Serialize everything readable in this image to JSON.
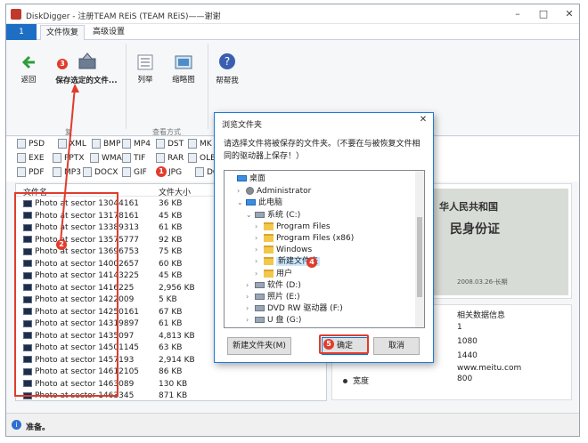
{
  "window": {
    "title": "DiskDigger - 注册TEAM REiS (TEAM REiS)——谢谢"
  },
  "ribbon_tabs": [
    {
      "label": "1"
    },
    {
      "label": "文件恢复"
    },
    {
      "label": "高级设置"
    }
  ],
  "ribbon": {
    "back": "返回",
    "save_selected": "保存选定的文件...",
    "list": "列举",
    "thumbs": "缩略图",
    "help": "帮帮我",
    "group_recover": "复",
    "group_view": "查看方式",
    "group_help": "帮"
  },
  "filters": {
    "row1": [
      "PSD",
      "XML",
      "BMP",
      "MP4",
      "DST",
      "MK"
    ],
    "row2": [
      "EXE",
      "PPTX",
      "WMA",
      "TIF",
      "RAR",
      "OLE"
    ],
    "row3": [
      "PDF",
      "MP3",
      "DOCX",
      "GIF",
      "JPG",
      "DOC"
    ]
  },
  "file_list": {
    "col_name": "文件名",
    "col_size": "文件大小",
    "rows": [
      {
        "name": "Photo at sector 13044161",
        "size": "36 KB"
      },
      {
        "name": "Photo at sector 13178161",
        "size": "45 KB"
      },
      {
        "name": "Photo at sector 13389313",
        "size": "61 KB"
      },
      {
        "name": "Photo at sector 13575777",
        "size": "92 KB"
      },
      {
        "name": "Photo at sector 13696753",
        "size": "75 KB"
      },
      {
        "name": "Photo at sector 14002657",
        "size": "60 KB"
      },
      {
        "name": "Photo at sector 14143225",
        "size": "45 KB"
      },
      {
        "name": "Photo at sector 1416225",
        "size": "2,956 KB"
      },
      {
        "name": "Photo at sector 1422009",
        "size": "5 KB"
      },
      {
        "name": "Photo at sector 14250161",
        "size": "67 KB"
      },
      {
        "name": "Photo at sector 14319897",
        "size": "61 KB"
      },
      {
        "name": "Photo at sector 1435097",
        "size": "4,813 KB"
      },
      {
        "name": "Photo at sector 14501145",
        "size": "63 KB"
      },
      {
        "name": "Photo at sector 1457193",
        "size": "2,914 KB"
      },
      {
        "name": "Photo at sector 14612105",
        "size": "86 KB"
      },
      {
        "name": "Photo at sector 1463089",
        "size": "130 KB"
      },
      {
        "name": "Photo at sector 1463345",
        "size": "871 KB"
      }
    ]
  },
  "preview_text": {
    "line1": "华人民共和国",
    "line2": "民身份证",
    "line3": "2008.03.26-长期"
  },
  "props": {
    "header": "相关数据信息",
    "values": [
      "1",
      "1080",
      "1440",
      "www.meitu.com",
      "800"
    ],
    "width_label": "宽度"
  },
  "dialog": {
    "title": "浏览文件夹",
    "instruction": "请选择文件将被保存的文件夹。（不要在与被恢复文件相同的驱动器上保存！）",
    "tree": [
      {
        "label": "桌面",
        "level": 0,
        "icon": "desktop-icon"
      },
      {
        "label": "Administrator",
        "level": 1,
        "icon": "user-icon"
      },
      {
        "label": "此电脑",
        "level": 1,
        "icon": "computer-icon"
      },
      {
        "label": "系统 (C:)",
        "level": 2,
        "icon": "drive-icon"
      },
      {
        "label": "Program Files",
        "level": 3,
        "icon": "folder-icon"
      },
      {
        "label": "Program Files (x86)",
        "level": 3,
        "icon": "folder-icon"
      },
      {
        "label": "Windows",
        "level": 3,
        "icon": "folder-icon"
      },
      {
        "label": "新建文件夹",
        "level": 3,
        "icon": "folder-icon"
      },
      {
        "label": "用户",
        "level": 3,
        "icon": "folder-icon"
      },
      {
        "label": "软件 (D:)",
        "level": 2,
        "icon": "drive-icon"
      },
      {
        "label": "照片 (E:)",
        "level": 2,
        "icon": "drive-icon"
      },
      {
        "label": "DVD RW 驱动器 (F:)",
        "level": 2,
        "icon": "dvd-icon"
      },
      {
        "label": "U 盘 (G:)",
        "level": 2,
        "icon": "usb-icon"
      }
    ],
    "new_folder": "新建文件夹(M)",
    "ok": "确定",
    "cancel": "取消"
  },
  "status": {
    "text": "准备。"
  },
  "badges": [
    "1",
    "2",
    "3",
    "4",
    "5"
  ],
  "colors": {
    "accent": "#1e7bd8",
    "annotation": "#e03c2c"
  }
}
